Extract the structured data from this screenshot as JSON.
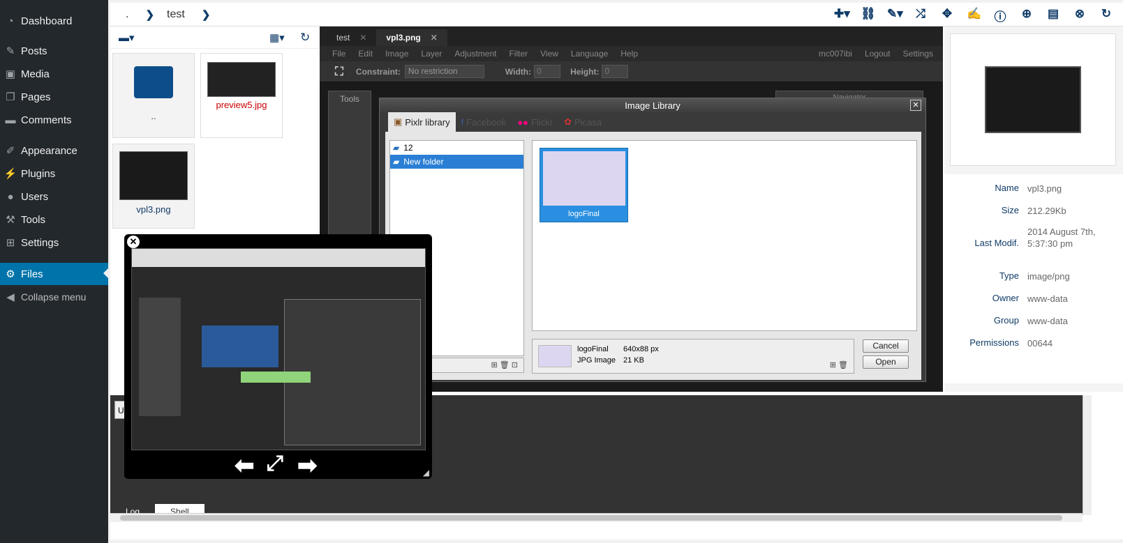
{
  "wp_menu": {
    "items": [
      "Dashboard",
      "Posts",
      "Media",
      "Pages",
      "Comments",
      "Appearance",
      "Plugins",
      "Users",
      "Tools",
      "Settings",
      "Files",
      "Collapse menu"
    ],
    "current": "Files"
  },
  "toolbar": {
    "crumbs": [
      ".",
      "test"
    ]
  },
  "files": [
    {
      "name": ".."
    },
    {
      "name": "preview5.jpg"
    },
    {
      "name": "vpl3.png"
    }
  ],
  "pixlr": {
    "tabs": [
      "test",
      "vpl3.png"
    ],
    "menu": [
      "File",
      "Edit",
      "Image",
      "Layer",
      "Adjustment",
      "Filter",
      "View",
      "Language",
      "Help"
    ],
    "user": "mc007ibi",
    "logout": "Logout",
    "settings": "Settings",
    "constraint_label": "Constraint:",
    "constraint_value": "No restriction",
    "width_label": "Width:",
    "width_value": "0",
    "height_label": "Height:",
    "height_value": "0",
    "tools_title": "Tools",
    "navigator_title": "Navigator"
  },
  "library": {
    "title": "Image Library",
    "tabs": [
      "Pixlr library",
      "Facebook",
      "Flickr",
      "Picasa"
    ],
    "folders": [
      "12",
      "New folder"
    ],
    "image_name": "logoFinal",
    "detail_name": "logoFinal",
    "detail_type": "JPG Image",
    "detail_dims": "640x88 px",
    "detail_size": "21 KB",
    "cancel": "Cancel",
    "open": "Open"
  },
  "info": {
    "rows": [
      {
        "k": "Name",
        "v": "vpl3.png"
      },
      {
        "k": "Size",
        "v": "212.29Kb"
      },
      {
        "k": "Last Modif.",
        "v": "2014 August 7th, 5:37:30 pm"
      },
      {
        "k": "Type",
        "v": "image/png"
      },
      {
        "k": "Owner",
        "v": "www-data"
      },
      {
        "k": "Group",
        "v": "www-data"
      },
      {
        "k": "Permissions",
        "v": "00644"
      }
    ]
  },
  "bottom": {
    "tabs": [
      "Log",
      "Shell"
    ],
    "partial_label": "Up"
  },
  "colors": {
    "wp_bg": "#23282d",
    "accent": "#0073aa",
    "link": "#0f3b68",
    "file_red": "#cc0000",
    "lib_sel": "#2a7fd5"
  }
}
